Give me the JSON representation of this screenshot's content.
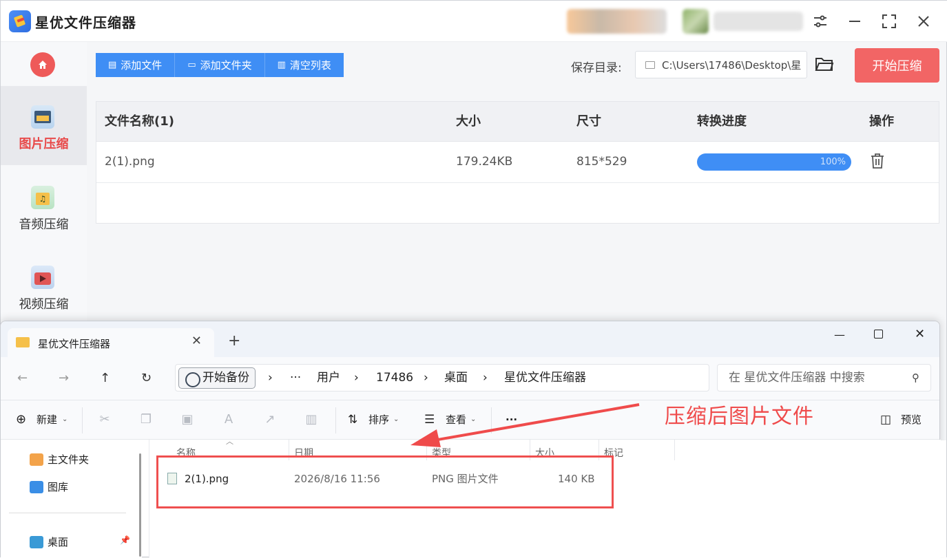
{
  "app": {
    "title": "星优文件压缩器"
  },
  "sidebar": {
    "items": [
      {
        "label": "图片压缩",
        "icon": "image-icon",
        "active": true
      },
      {
        "label": "音频压缩",
        "icon": "audio-icon",
        "active": false
      },
      {
        "label": "视频压缩",
        "icon": "video-icon",
        "active": false
      }
    ]
  },
  "toolbar": {
    "add_file": "添加文件",
    "add_folder": "添加文件夹",
    "clear_list": "清空列表",
    "save_label": "保存目录:",
    "save_path": "C:\\Users\\17486\\Desktop\\星",
    "start": "开始压缩"
  },
  "table": {
    "headers": [
      "文件名称(1)",
      "大小",
      "尺寸",
      "转换进度",
      "操作"
    ],
    "rows": [
      {
        "name": "2(1).png",
        "size": "179.24KB",
        "dimensions": "815*529",
        "progress": 100,
        "progress_text": "100%"
      }
    ]
  },
  "explorer": {
    "tab_title": "星优文件压缩器",
    "backup": "开始备份",
    "breadcrumb": [
      "用户",
      "17486",
      "桌面",
      "星优文件压缩器"
    ],
    "ellipsis": "···",
    "search_placeholder": "在 星优文件压缩器 中搜索",
    "commands": {
      "new": "新建",
      "sort": "排序",
      "view": "查看",
      "more": "···",
      "preview": "预览"
    },
    "nav": [
      "主文件夹",
      "图库",
      "桌面"
    ],
    "columns": [
      "名称",
      "日期",
      "类型",
      "大小",
      "标记"
    ],
    "files": [
      {
        "name": "2(1).png",
        "date": "2026/8/16 11:56",
        "type": "PNG 图片文件",
        "size": "140 KB"
      }
    ]
  },
  "annotation": "压缩后图片文件",
  "colors": {
    "accent_blue": "#3f8ef5",
    "accent_red": "#f26565",
    "annotation_red": "#ef4b4b"
  }
}
